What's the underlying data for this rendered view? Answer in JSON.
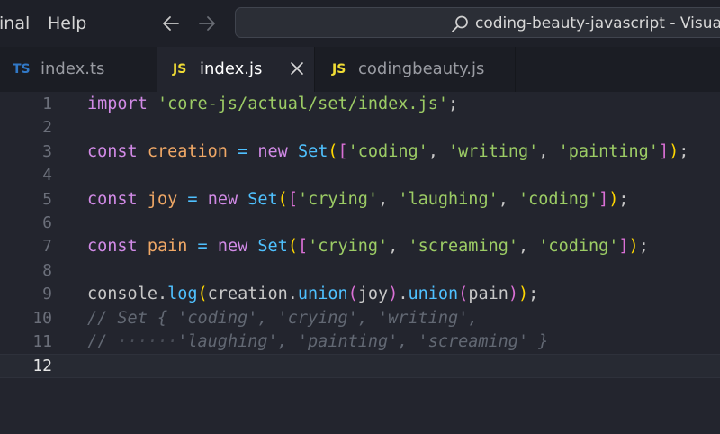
{
  "window": {
    "menu_items": [
      "inal",
      "Help"
    ],
    "search_text": "coding-beauty-javascript - Visual S"
  },
  "tabs": [
    {
      "icon": "TS",
      "label": "index.ts",
      "active": false,
      "icon_color": "#3178c6"
    },
    {
      "icon": "JS",
      "label": "index.js",
      "active": true,
      "icon_color": "#f1dd35"
    },
    {
      "icon": "JS",
      "label": "codingbeauty.js",
      "active": false,
      "icon_color": "#f1dd35"
    }
  ],
  "editor": {
    "current_line": 12,
    "line_numbers": [
      "1",
      "2",
      "3",
      "4",
      "5",
      "6",
      "7",
      "8",
      "9",
      "10",
      "11",
      "12"
    ],
    "lines": [
      [
        {
          "t": "import",
          "c": "kw"
        },
        {
          "t": " ",
          "c": "punc"
        },
        {
          "t": "'core-js/actual/set/index.js'",
          "c": "str"
        },
        {
          "t": ";",
          "c": "punc"
        }
      ],
      [],
      [
        {
          "t": "const",
          "c": "kw"
        },
        {
          "t": " ",
          "c": "punc"
        },
        {
          "t": "creation",
          "c": "var"
        },
        {
          "t": " ",
          "c": "punc"
        },
        {
          "t": "=",
          "c": "op"
        },
        {
          "t": " ",
          "c": "punc"
        },
        {
          "t": "new",
          "c": "kw"
        },
        {
          "t": " ",
          "c": "punc"
        },
        {
          "t": "Set",
          "c": "cls"
        },
        {
          "t": "(",
          "c": "b1"
        },
        {
          "t": "[",
          "c": "b2"
        },
        {
          "t": "'coding'",
          "c": "str"
        },
        {
          "t": ", ",
          "c": "punc"
        },
        {
          "t": "'writing'",
          "c": "str"
        },
        {
          "t": ", ",
          "c": "punc"
        },
        {
          "t": "'painting'",
          "c": "str"
        },
        {
          "t": "]",
          "c": "b2"
        },
        {
          "t": ")",
          "c": "b1"
        },
        {
          "t": ";",
          "c": "punc"
        }
      ],
      [],
      [
        {
          "t": "const",
          "c": "kw"
        },
        {
          "t": " ",
          "c": "punc"
        },
        {
          "t": "joy",
          "c": "var"
        },
        {
          "t": " ",
          "c": "punc"
        },
        {
          "t": "=",
          "c": "op"
        },
        {
          "t": " ",
          "c": "punc"
        },
        {
          "t": "new",
          "c": "kw"
        },
        {
          "t": " ",
          "c": "punc"
        },
        {
          "t": "Set",
          "c": "cls"
        },
        {
          "t": "(",
          "c": "b1"
        },
        {
          "t": "[",
          "c": "b2"
        },
        {
          "t": "'crying'",
          "c": "str"
        },
        {
          "t": ", ",
          "c": "punc"
        },
        {
          "t": "'laughing'",
          "c": "str"
        },
        {
          "t": ", ",
          "c": "punc"
        },
        {
          "t": "'coding'",
          "c": "str"
        },
        {
          "t": "]",
          "c": "b2"
        },
        {
          "t": ")",
          "c": "b1"
        },
        {
          "t": ";",
          "c": "punc"
        }
      ],
      [],
      [
        {
          "t": "const",
          "c": "kw"
        },
        {
          "t": " ",
          "c": "punc"
        },
        {
          "t": "pain",
          "c": "var"
        },
        {
          "t": " ",
          "c": "punc"
        },
        {
          "t": "=",
          "c": "op"
        },
        {
          "t": " ",
          "c": "punc"
        },
        {
          "t": "new",
          "c": "kw"
        },
        {
          "t": " ",
          "c": "punc"
        },
        {
          "t": "Set",
          "c": "cls"
        },
        {
          "t": "(",
          "c": "b1"
        },
        {
          "t": "[",
          "c": "b2"
        },
        {
          "t": "'crying'",
          "c": "str"
        },
        {
          "t": ", ",
          "c": "punc"
        },
        {
          "t": "'screaming'",
          "c": "str"
        },
        {
          "t": ", ",
          "c": "punc"
        },
        {
          "t": "'coding'",
          "c": "str"
        },
        {
          "t": "]",
          "c": "b2"
        },
        {
          "t": ")",
          "c": "b1"
        },
        {
          "t": ";",
          "c": "punc"
        }
      ],
      [],
      [
        {
          "t": "console",
          "c": "punc"
        },
        {
          "t": ".",
          "c": "punc"
        },
        {
          "t": "log",
          "c": "fn"
        },
        {
          "t": "(",
          "c": "b1"
        },
        {
          "t": "creation",
          "c": "punc"
        },
        {
          "t": ".",
          "c": "punc"
        },
        {
          "t": "union",
          "c": "fn"
        },
        {
          "t": "(",
          "c": "b2"
        },
        {
          "t": "joy",
          "c": "punc"
        },
        {
          "t": ")",
          "c": "b2"
        },
        {
          "t": ".",
          "c": "punc"
        },
        {
          "t": "union",
          "c": "fn"
        },
        {
          "t": "(",
          "c": "b2"
        },
        {
          "t": "pain",
          "c": "punc"
        },
        {
          "t": ")",
          "c": "b2"
        },
        {
          "t": ")",
          "c": "b1"
        },
        {
          "t": ";",
          "c": "punc"
        }
      ],
      [
        {
          "t": "// Set { 'coding', 'crying', 'writing',",
          "c": "cmt"
        }
      ],
      [
        {
          "t": "// ",
          "c": "cmt"
        },
        {
          "t": "······",
          "c": "ws"
        },
        {
          "t": "'laughing', 'painting', 'screaming' }",
          "c": "cmt"
        }
      ],
      []
    ]
  }
}
